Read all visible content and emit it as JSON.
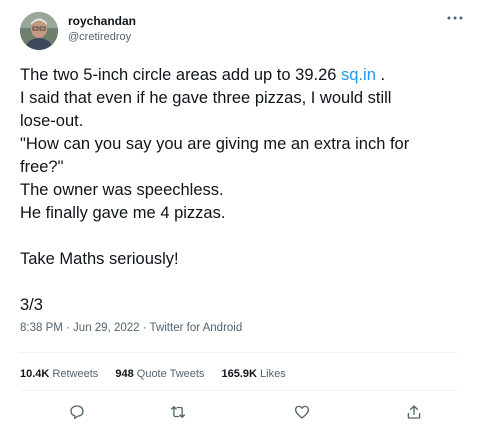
{
  "author": {
    "display_name": "roychandan",
    "handle": "@cretiredroy"
  },
  "tweet": {
    "line1_prefix": "The two 5-inch circle areas add up to 39.26 ",
    "line1_link": "sq.in",
    "line1_suffix": " .",
    "line2": "I said that even if he gave three pizzas, I would still",
    "line3": "lose-out.",
    "line4": "\"How can you say you are giving me an extra inch for",
    "line5": "free?\"",
    "line6": "The owner was speechless.",
    "line7": "He finally gave me 4 pizzas.",
    "line8": "Take Maths seriously!",
    "line9": "3/3"
  },
  "meta": {
    "timestamp": "8:38 PM · Jun 29, 2022 · Twitter for Android"
  },
  "stats": {
    "retweets_count": "10.4K",
    "retweets_label": "Retweets",
    "quotes_count": "948",
    "quotes_label": "Quote Tweets",
    "likes_count": "165.9K",
    "likes_label": "Likes"
  },
  "icons": {
    "more": "more-icon",
    "reply": "reply-icon",
    "retweet": "retweet-icon",
    "like": "like-icon",
    "share": "share-icon"
  },
  "colors": {
    "link": "#1d9bf0",
    "secondary_text": "#536471",
    "primary_text": "#0f1419"
  }
}
